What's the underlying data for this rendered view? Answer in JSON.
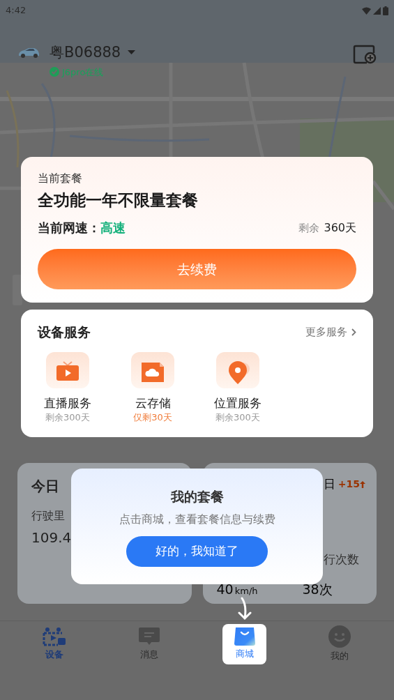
{
  "status_bar": {
    "time": "4:42"
  },
  "vehicle": {
    "plate": "粤B06888",
    "status": "J6pro在线",
    "online": true
  },
  "plan_card": {
    "label": "当前套餐",
    "name": "全功能一年不限量套餐",
    "speed_label": "当前网速：",
    "speed": "高速",
    "remaining_label": "剩余",
    "remaining": "360天",
    "button": "去续费"
  },
  "services": {
    "title": "设备服务",
    "more": "更多服务",
    "items": [
      {
        "kind": "live",
        "name": "直播服务",
        "remaining": "剩余300天",
        "warning": false
      },
      {
        "kind": "cloud",
        "name": "云存储",
        "remaining": "仅剩30天",
        "warning": true
      },
      {
        "kind": "location",
        "name": "位置服务",
        "remaining": "剩余300天",
        "warning": false
      }
    ]
  },
  "stats": {
    "left": {
      "title": "今日",
      "label": "行驶里",
      "value": "109.4"
    },
    "right": {
      "title": "日",
      "change": "+15",
      "label": "行次数",
      "speed": "40",
      "speed_unit": "km/h",
      "count": "38次"
    }
  },
  "tip": {
    "title": "我的套餐",
    "text": "点击商城，查看套餐信息与续费",
    "button": "好的，我知道了"
  },
  "tabs": [
    {
      "label": "设备",
      "selected": true,
      "spotlight": false
    },
    {
      "label": "消息",
      "selected": false,
      "spotlight": false
    },
    {
      "label": "商城",
      "selected": false,
      "spotlight": true
    },
    {
      "label": "我的",
      "selected": false,
      "spotlight": false
    }
  ]
}
